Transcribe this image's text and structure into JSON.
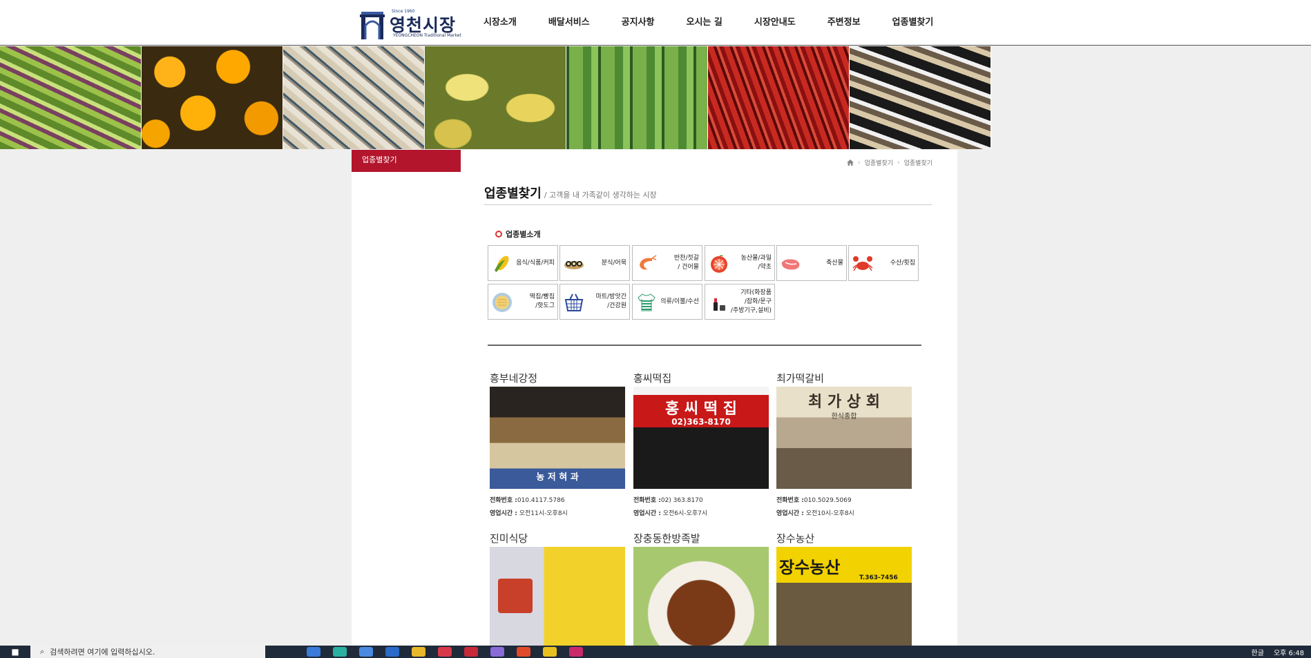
{
  "logo": {
    "since": "Since 1960",
    "name": "영천시장",
    "subname": "YEONGCHEON Traditional Market"
  },
  "nav": [
    "시장소개",
    "배달서비스",
    "공지사항",
    "오시는 길",
    "시장안내도",
    "주변정보",
    "업종별찾기"
  ],
  "banner_alt": [
    "채소",
    "오렌지",
    "강정",
    "튀김",
    "오이",
    "고추",
    "신발"
  ],
  "sidebar": {
    "title": "업종별찾기"
  },
  "breadcrumb": {
    "home_icon": "home-icon",
    "items": [
      "업종별찾기",
      "업종별찾기"
    ]
  },
  "page": {
    "title": "업종별찾기",
    "subtitle": "/ 고객을 내 가족같이 생각하는 시장"
  },
  "section": {
    "label": "업종별소개"
  },
  "categories": [
    {
      "icon": "corn-icon",
      "label": "음식/식품/커피"
    },
    {
      "icon": "gimbap-icon",
      "label": "분식/어묵"
    },
    {
      "icon": "shrimp-icon",
      "label": "반찬/젓갈\n/ 건어물"
    },
    {
      "icon": "grapefruit-icon",
      "label": "농산물/과일\n/약초"
    },
    {
      "icon": "meat-icon",
      "label": "축산물"
    },
    {
      "icon": "crab-icon",
      "label": "수산/횟집"
    },
    {
      "icon": "bread-icon",
      "label": "떡집/빵집\n/핫도그"
    },
    {
      "icon": "basket-icon",
      "label": "마트/방앗간\n/건강원"
    },
    {
      "icon": "shirt-icon",
      "label": "의류/이불/수선"
    },
    {
      "icon": "cosmetics-icon",
      "label": "기타(화장품\n/잡화/문구\n/주방기구,설비)"
    }
  ],
  "shops": [
    {
      "name": "흥부네강정",
      "phone_label": "전화번호 :",
      "phone": "010.4117.5786",
      "hours_label": "영업시간 :",
      "hours": "오전11시-오후8시",
      "photo_text": "농 저 혀 과"
    },
    {
      "name": "홍씨떡집",
      "phone_label": "전화번호 :",
      "phone": "02) 363.8170",
      "hours_label": "영업시간 :",
      "hours": "오전6시-오후7시",
      "photo_text": "홍 씨 떡 집",
      "photo_sub": "02)363-8170"
    },
    {
      "name": "최가떡갈비",
      "phone_label": "전화번호 :",
      "phone": "010.5029.5069",
      "hours_label": "영업시간 :",
      "hours": "오전10시-오후8시",
      "photo_text": "최 가 상 회",
      "photo_sub": "한식종합"
    },
    {
      "name": "진미식당",
      "photo_text": ""
    },
    {
      "name": "장충동한방족발",
      "photo_text": ""
    },
    {
      "name": "장수농산",
      "photo_text": "장수농산",
      "photo_sub": "T.363-7456"
    }
  ],
  "taskbar": {
    "search_placeholder": "검색하려면 여기에 입력하십시오.",
    "tray_lang": "한글",
    "tray_time": "오후 6:48"
  },
  "colors": {
    "accent": "#b3152c",
    "navy": "#1a2a5a"
  }
}
